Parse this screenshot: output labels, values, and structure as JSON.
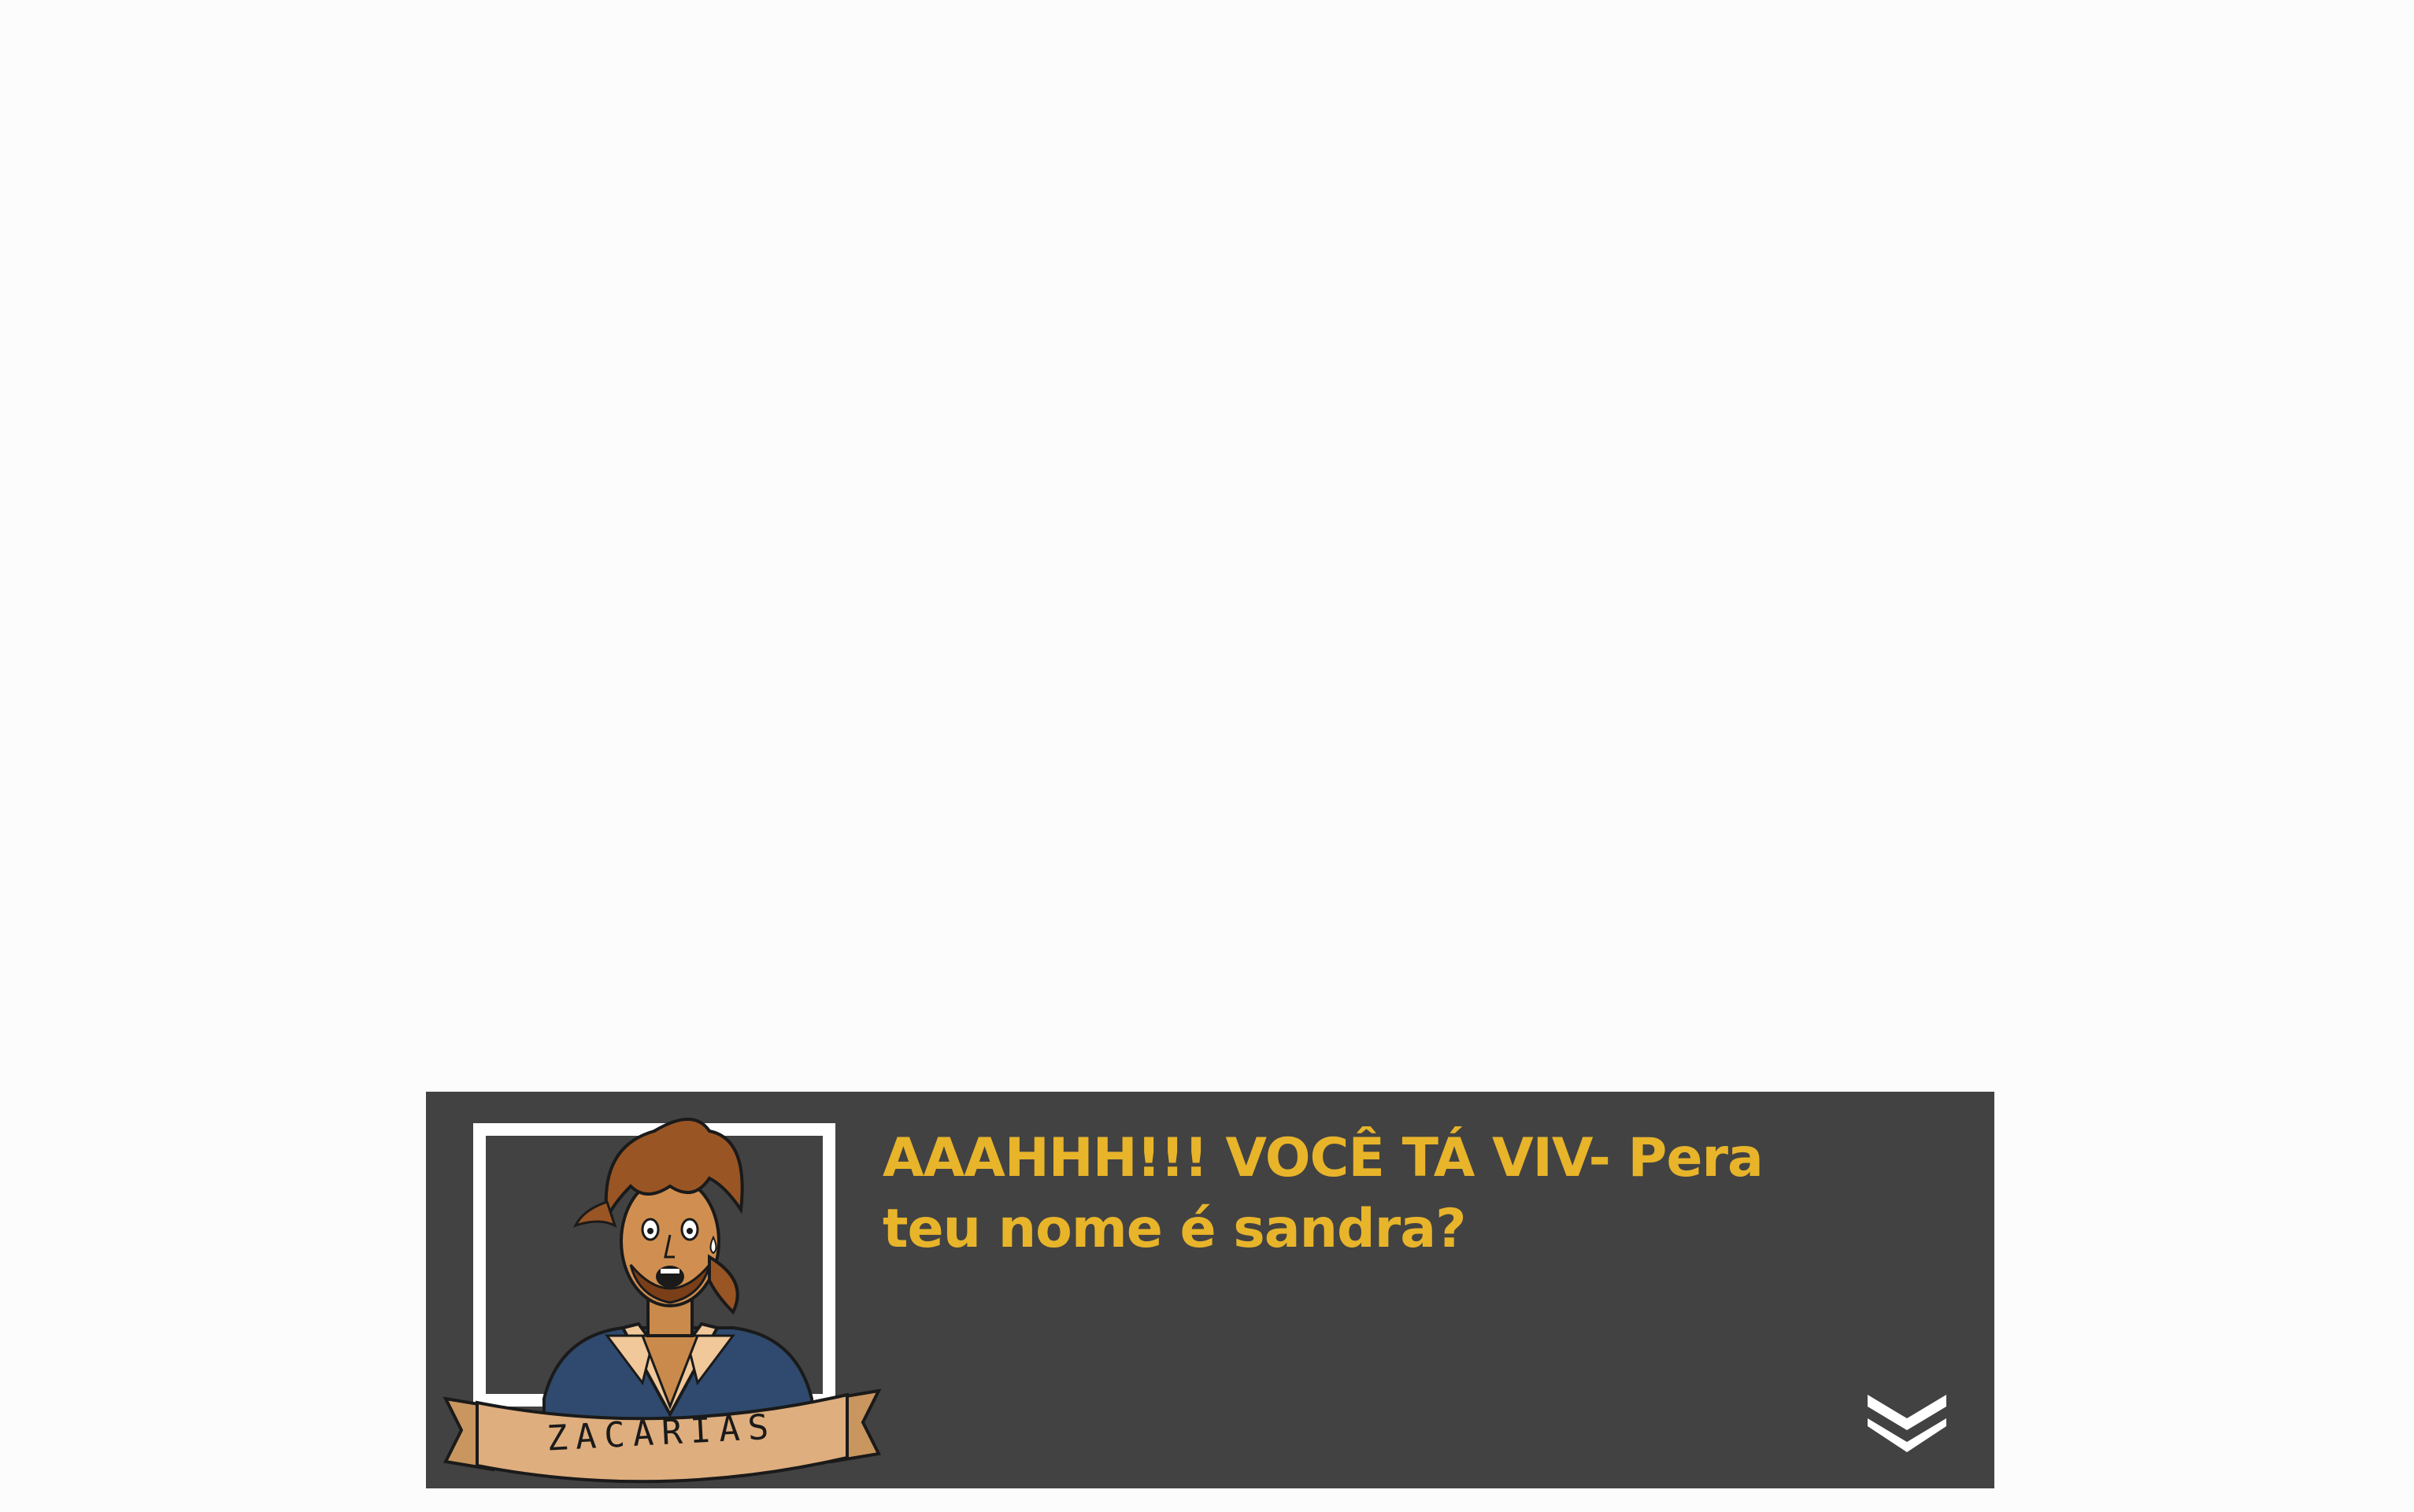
{
  "dialog": {
    "speaker_name": "ZACARIAS",
    "text": "AAAHHH!!! VOCÊ TÁ VIV- Pera teu nome é sandra?"
  },
  "colors": {
    "dialog_bg": "#424242",
    "text": "#e8b42a",
    "frame": "#ffffff",
    "banner": "#dfae7e"
  },
  "icons": {
    "advance": "double-chevron-down-icon"
  }
}
